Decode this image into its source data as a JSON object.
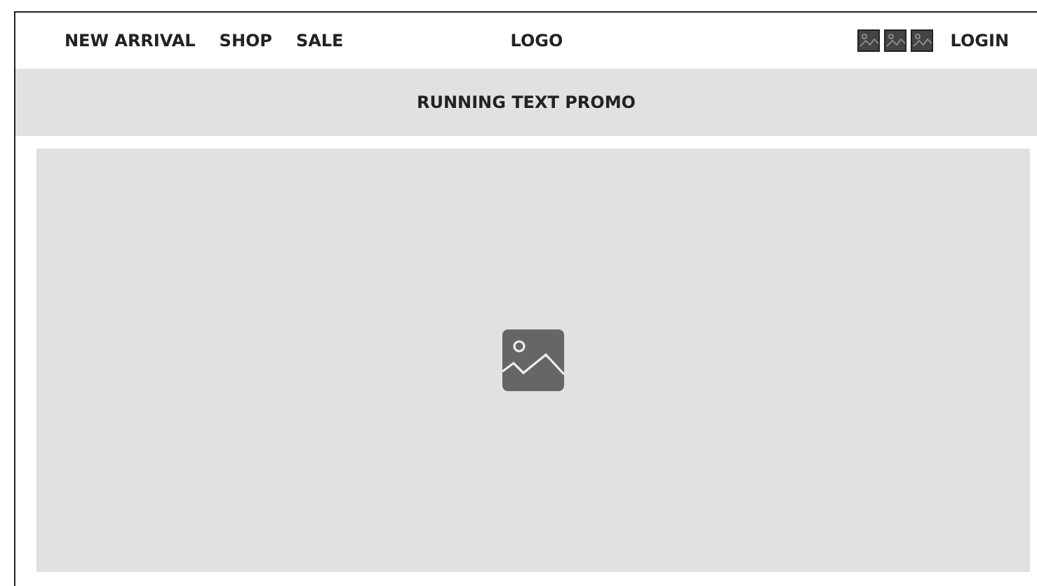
{
  "nav": {
    "links": [
      "NEW ARRIVAL",
      "SHOP",
      "SALE"
    ],
    "logo": "LOGO",
    "login": "LOGIN"
  },
  "promo": {
    "text": "RUNNING TEXT PROMO"
  },
  "hero": {
    "kind": "placeholder"
  }
}
